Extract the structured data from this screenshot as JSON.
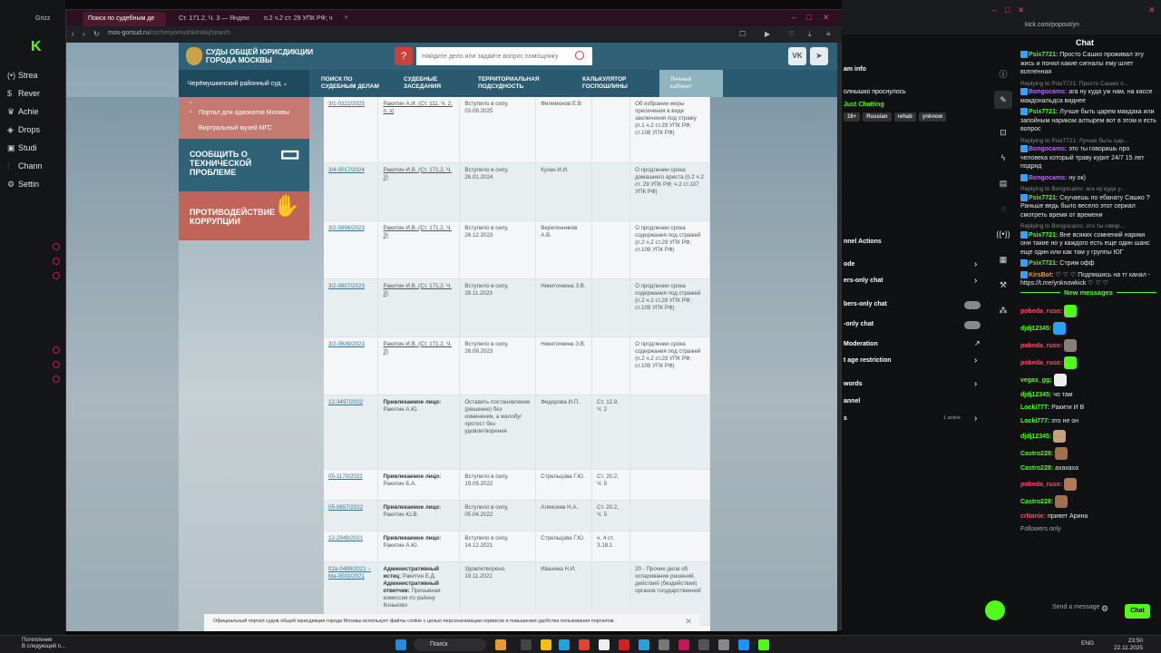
{
  "left_app": {
    "logo": "K",
    "nav": [
      {
        "label": "Strea",
        "icon": "(•)"
      },
      {
        "label": "Rever",
        "icon": "$"
      },
      {
        "label": "Achie",
        "icon": "♛"
      },
      {
        "label": "Drops",
        "icon": "◈"
      },
      {
        "label": "Studi",
        "icon": "▣"
      },
      {
        "label": "Chann",
        "icon": "⫶"
      },
      {
        "label": "Settin",
        "icon": "⚙"
      }
    ]
  },
  "browser": {
    "tabs": [
      {
        "label": "Grizz"
      },
      {
        "label": "Поиск по судебным де"
      },
      {
        "label": "Ст. 171.2, Ч. 3 — Яндекс"
      },
      {
        "label": "п.2 ч.2 ст. 29 УПК РФ; ч"
      }
    ],
    "url_host": "mos-gorsud.ru",
    "url_path": "/rs/cheryomushkinskij/search"
  },
  "site": {
    "title": "СУДЫ ОБЩЕЙ ЮРИСДИКЦИИ ГОРОДА МОСКВЫ",
    "search_placeholder": "Найдите дело или задайте вопрос помощнику",
    "help": "?",
    "vk": "VK",
    "tg": "➤",
    "court_select": "Черёмушкинский районный суд",
    "nav": [
      {
        "label": "Поиск по судебным делам"
      },
      {
        "label": "Судебные заседания"
      },
      {
        "label": "Территориальная подсудность"
      },
      {
        "label": "Калькулятор госпошлины"
      }
    ],
    "cabinet": "Личный кабинет",
    "side_links": [
      {
        "label": "Портал для адвокатов Москвы"
      },
      {
        "label": "Виртуальный музей МГС"
      }
    ],
    "report_block": "СООБЩИТЬ О ТЕХНИЧЕСКОЙ ПРОБЛЕМЕ",
    "corruption_block": "ПРОТИВОДЕЙСТВИЕ КОРРУПЦИИ",
    "rows": [
      {
        "num": "3/1-0322/2025",
        "party": "Ракитин А.И. (Ст. 111, Ч. 2, п. з)",
        "status": "Вступило в силу, 03.09.2025",
        "judge": "Филимонов Е.В",
        "article": "",
        "category": "Об избрании меры пресечения в виде заключения под стражу (п.1 ч.2 ст.29 УПК РФ; ст.108 УПК РФ)"
      },
      {
        "num": "3/4-0017/2024",
        "party": "Ракитин И.В. (Ст. 171.2, Ч. 3)",
        "status": "Вступило в силу, 26.01.2024",
        "judge": "Кузан И.И.",
        "article": "",
        "category": "О продлении срока домашнего ареста (п.2 ч.2 ст. 29 УПК РФ; ч.2 ст.107 УПК РФ)"
      },
      {
        "num": "3/2-0896/2023",
        "party": "Ракитин И.В. (Ст. 171.2, Ч. 3)",
        "status": "Вступило в силу, 26.12.2023",
        "judge": "Веретенников А.В.",
        "article": "",
        "category": "О продлении срока содержания под стражей (п.2 ч.2 ст.29 УПК РФ; ст.109 УПК РФ)"
      },
      {
        "num": "3/2-0807/2023",
        "party": "Ракитин И.В. (Ст. 171.2, Ч. 3)",
        "status": "Вступило в силу, 28.11.2023",
        "judge": "Никиточкина З.В.",
        "article": "",
        "category": "О продлении срока содержания под стражей (п.2 ч.2 ст.29 УПК РФ; ст.109 УПК РФ)"
      },
      {
        "num": "3/2-0639/2023",
        "party": "Ракитин И.В. (Ст. 171.2, Ч. 3)",
        "status": "Вступило в силу, 26.09.2023",
        "judge": "Никиточкина З.В.",
        "article": "",
        "category": "О продлении срока содержания под стражей (п.2 ч.2 ст.29 УПК РФ; ст.109 УПК РФ)"
      },
      {
        "num": "12-3497/2022",
        "party_label": "Привлекаемое лицо:",
        "party": "Ракитин А.Ю.",
        "status": "Оставить постановление (решение) без изменения, а жалобу/протест без удовлетворения",
        "judge": "Федорова И.П.",
        "article": "Ст. 12.9, Ч. 2",
        "category": ""
      },
      {
        "num": "05-1170/2022",
        "party_label": "Привлекаемое лицо:",
        "party": "Ракитин Б.А.",
        "status": "Вступило в силу, 19.09.2022",
        "judge": "Стрельцова Г.Ю.",
        "article": "Ст. 20.2, Ч. 5",
        "category": ""
      },
      {
        "num": "05-0657/2022",
        "party_label": "Привлекаемое лицо:",
        "party": "Ракитин Ю.В.",
        "status": "Вступило в силу, 05.04.2022",
        "judge": "Алексеев Н.А.",
        "article": "Ст. 20.2, Ч. 5",
        "category": ""
      },
      {
        "num": "12-2949/2021",
        "party_label": "Привлекаемое лицо:",
        "party": "Ракитин А.Ю.",
        "status": "Вступило в силу, 14.12.2021",
        "judge": "Стрельцова Г.Ю.",
        "article": "ч. 4 ст. 3.18.1",
        "category": ""
      },
      {
        "num": "02а-0499/2021 ~ Ма-0503/2021",
        "party_label": "Административный истец:",
        "party": "Ракитин Е.Д.",
        "party_label2": "Административный ответчик:",
        "party2": "Призывная комиссия по району Коньково",
        "status": "Удовлетворено, 19.11.2021",
        "judge": "Ивахина Н.И.",
        "article": "",
        "category": "20 - Прочие дела об оспаривании решений, действий (бездействия) органов государственной"
      }
    ],
    "cookie_text": "Официальный портал судов общей юрисдикции города Москвы использует файлы cookie с целью персонализации сервисов и повышения удобства пользования порталом."
  },
  "chat": {
    "url": "kick.com/popout/yn",
    "title": "Chat",
    "stream_info": "am info",
    "status_text": "олнышко проснулось",
    "category": "Just Chatting",
    "tags": [
      "18+",
      "Russian",
      "rehab",
      "ynknow"
    ],
    "actions_title": "nnel Actions",
    "actions": [
      {
        "label": "ode",
        "control": "chevron"
      },
      {
        "label": "ers-only chat",
        "control": "chevron"
      },
      {
        "label": "bers-only chat",
        "control": "toggle"
      },
      {
        "label": "-only chat",
        "control": "toggle"
      },
      {
        "label": "Moderation",
        "control": "link"
      },
      {
        "label": "t age restriction",
        "control": "chevron"
      },
      {
        "label": "words",
        "control": "chevron"
      },
      {
        "label": "annel",
        "control": ""
      },
      {
        "label": "s",
        "control": "chevron",
        "extra": "1 active"
      }
    ],
    "messages": [
      {
        "reply": "",
        "user": "Psix7721:",
        "color": "#53fc18",
        "text": "Просто Сашко проживал эту жись и понял какие сигналы ему шлет вселенная"
      },
      {
        "reply": "Replying to Psix7721: Просто Сашко п...",
        "user": "Bongocams:",
        "color": "#b26bff",
        "text": "ага ну куда уж нам, на кассе макдональдса виднее"
      },
      {
        "reply": "",
        "user": "Psix7721:",
        "color": "#53fc18",
        "text": "Лучше быть царем макдака или запойным нариком алтырем вот в этом и есть вопрос"
      },
      {
        "reply": "Replying to Psix7721: Лучше быть цар...",
        "user": "Bongocams:",
        "color": "#b26bff",
        "text": "это ты говоришь про человека который траву курит 24/7 15 лет подряд"
      },
      {
        "reply": "",
        "user": "Bongocams:",
        "color": "#b26bff",
        "text": "ну ок)"
      },
      {
        "reply": "Replying to Bongocams: ага ну куда у...",
        "user": "Psix7721:",
        "color": "#53fc18",
        "text": "Скучаешь по ебанату Сашко ? Раньше ведь было весело этот сериал смотреть время от времени"
      },
      {
        "reply": "Replying to Bongocams: это ты говор...",
        "user": "Psix7721:",
        "color": "#53fc18",
        "text": "Вне всяких сомнений нарики они такие но у каждого есть еще один шанс еще один или как там у группы ЮГ"
      },
      {
        "reply": "",
        "user": "Psix7721:",
        "color": "#53fc18",
        "text": "Стрим офф"
      },
      {
        "reply": "",
        "user": "KirsBot:",
        "color": "#e8a13a",
        "text": "♡ ♡ ♡ Подпишись на тг канал - https://t.me/ynknowkick ♡ ♡ ♡"
      }
    ],
    "new_messages_label": "New messages",
    "new_messages": [
      {
        "user": "pobeda_ruso:",
        "color": "#ff4d6a",
        "text": "",
        "emote": "#53fc18"
      },
      {
        "user": "djdj12345:",
        "color": "#53fc18",
        "text": "",
        "emote": "#2aa3ff"
      },
      {
        "user": "pobeda_ruso:",
        "color": "#ff4d6a",
        "text": "",
        "emote": "#8a7f77"
      },
      {
        "user": "pobeda_ruso:",
        "color": "#ff4d6a",
        "text": "",
        "emote": "#53fc18"
      },
      {
        "user": "vegas_gg:",
        "color": "#53fc18",
        "text": "",
        "emote": "#eeeeee"
      },
      {
        "user": "djdj12345:",
        "color": "#53fc18",
        "text": "чо там",
        "emote": ""
      },
      {
        "user": "Locki777:",
        "color": "#53fc18",
        "text": "Ракити И В",
        "emote": ""
      },
      {
        "user": "Locki777:",
        "color": "#53fc18",
        "text": "это не он",
        "emote": ""
      },
      {
        "user": "djdj12345:",
        "color": "#53fc18",
        "text": "",
        "emote": "#c8a080"
      },
      {
        "user": "Castro228:",
        "color": "#53fc18",
        "text": "",
        "emote": "#a0704f"
      },
      {
        "user": "Castro228:",
        "color": "#53fc18",
        "text": "ахахаха",
        "emote": ""
      },
      {
        "user": "pobeda_ruso:",
        "color": "#ff4d6a",
        "text": "",
        "emote": "#b07a5a"
      },
      {
        "user": "Castro228:",
        "color": "#53fc18",
        "text": "",
        "emote": "#a0704f"
      },
      {
        "user": "crNanie:",
        "color": "#ff4d6a",
        "text": "привет Арина",
        "emote": ""
      }
    ],
    "followers_only": "Followers only",
    "input_placeholder": "Send a message",
    "send_label": "Chat"
  },
  "taskbar": {
    "weather_line1": "Потепление",
    "weather_line2": "В следующий п...",
    "search": "Поиск",
    "lang": "ENG",
    "time": "23:50",
    "date": "22.11.2025"
  }
}
